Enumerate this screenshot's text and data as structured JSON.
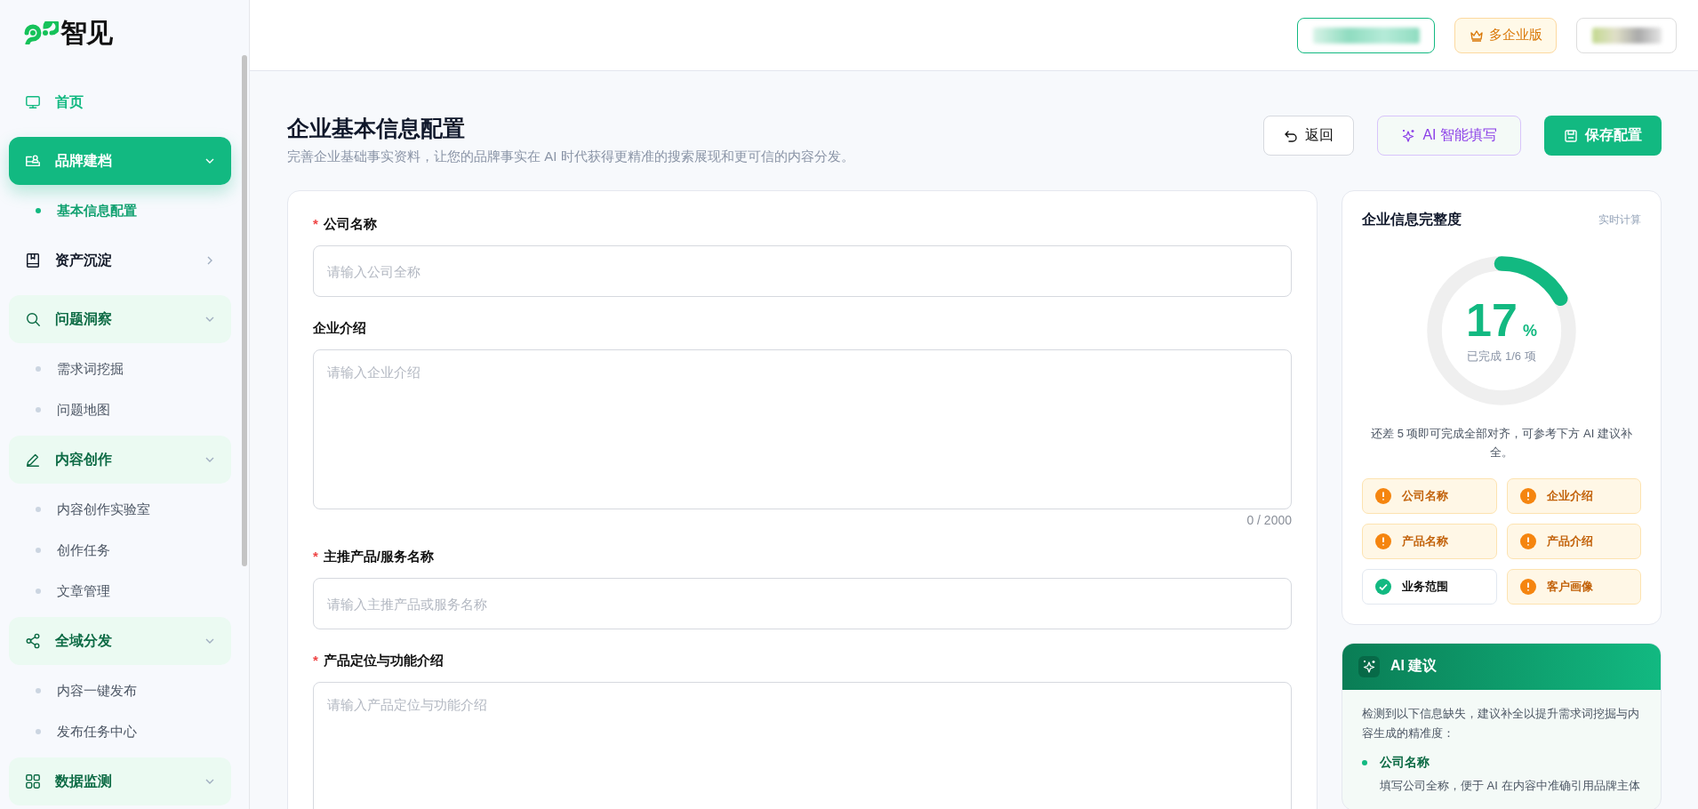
{
  "brand": {
    "name": "智见"
  },
  "sidebar": {
    "items": [
      {
        "label": "首页",
        "kind": "link",
        "selected": false
      },
      {
        "label": "品牌建档",
        "kind": "group",
        "selected": true,
        "expanded": true,
        "children": [
          {
            "label": "基本信息配置",
            "selected": true
          }
        ]
      },
      {
        "label": "资产沉淀",
        "kind": "group",
        "selected": false,
        "expanded": false
      },
      {
        "label": "问题洞察",
        "kind": "group",
        "selected": false,
        "expanded": true,
        "children": [
          {
            "label": "需求词挖掘",
            "selected": false
          },
          {
            "label": "问题地图",
            "selected": false
          }
        ]
      },
      {
        "label": "内容创作",
        "kind": "group",
        "selected": false,
        "expanded": true,
        "children": [
          {
            "label": "内容创作实验室",
            "selected": false
          },
          {
            "label": "创作任务",
            "selected": false
          },
          {
            "label": "文章管理",
            "selected": false
          }
        ]
      },
      {
        "label": "全域分发",
        "kind": "group",
        "selected": false,
        "expanded": true,
        "children": [
          {
            "label": "内容一键发布",
            "selected": false
          },
          {
            "label": "发布任务中心",
            "selected": false
          }
        ]
      },
      {
        "label": "数据监测",
        "kind": "group",
        "selected": false,
        "expanded": true
      }
    ]
  },
  "header": {
    "plan_badge": "多企业版"
  },
  "page": {
    "title": "企业基本信息配置",
    "subtitle": "完善企业基础事实资料，让您的品牌事实在 AI 时代获得更精准的搜索展现和更可信的内容分发。",
    "buttons": [
      {
        "label": "返回",
        "kind": "back"
      },
      {
        "label": "AI 智能填写",
        "kind": "ai"
      },
      {
        "label": "保存配置",
        "kind": "save"
      }
    ]
  },
  "form": {
    "fields": [
      {
        "label": "公司名称",
        "required_mark": "*",
        "kind": "input",
        "placeholder": "请输入公司全称"
      },
      {
        "label": "企业介绍",
        "kind": "textarea",
        "placeholder": "请输入企业介绍",
        "counter": "0 / 2000"
      },
      {
        "label": "主推产品/服务名称",
        "required_mark": "*",
        "kind": "input",
        "placeholder": "请输入主推产品或服务名称"
      },
      {
        "label": "产品定位与功能介绍",
        "required_mark": "*",
        "kind": "textarea",
        "placeholder": "请输入产品定位与功能介绍"
      }
    ]
  },
  "completeness": {
    "title": "企业信息完整度",
    "note": "实时计算",
    "level": 0.17,
    "percent": "17",
    "percent_sign": "%",
    "progress_text": "已完成 1/6 项",
    "hint": "还差 5 项即可完成全部对齐，可参考下方 AI 建议补全。",
    "items": [
      {
        "label": "公司名称",
        "done": false
      },
      {
        "label": "企业介绍",
        "done": false
      },
      {
        "label": "产品名称",
        "done": false
      },
      {
        "label": "产品介绍",
        "done": false
      },
      {
        "label": "业务范围",
        "done": true
      },
      {
        "label": "客户画像",
        "done": false
      }
    ]
  },
  "ai_suggestion": {
    "title": "AI 建议",
    "intro": "检测到以下信息缺失，建议补全以提升需求词挖掘与内容生成的精准度：",
    "items": [
      {
        "title": "公司名称",
        "text": "填写公司全称，便于 AI 在内容中准确引用品牌主体"
      }
    ]
  }
}
